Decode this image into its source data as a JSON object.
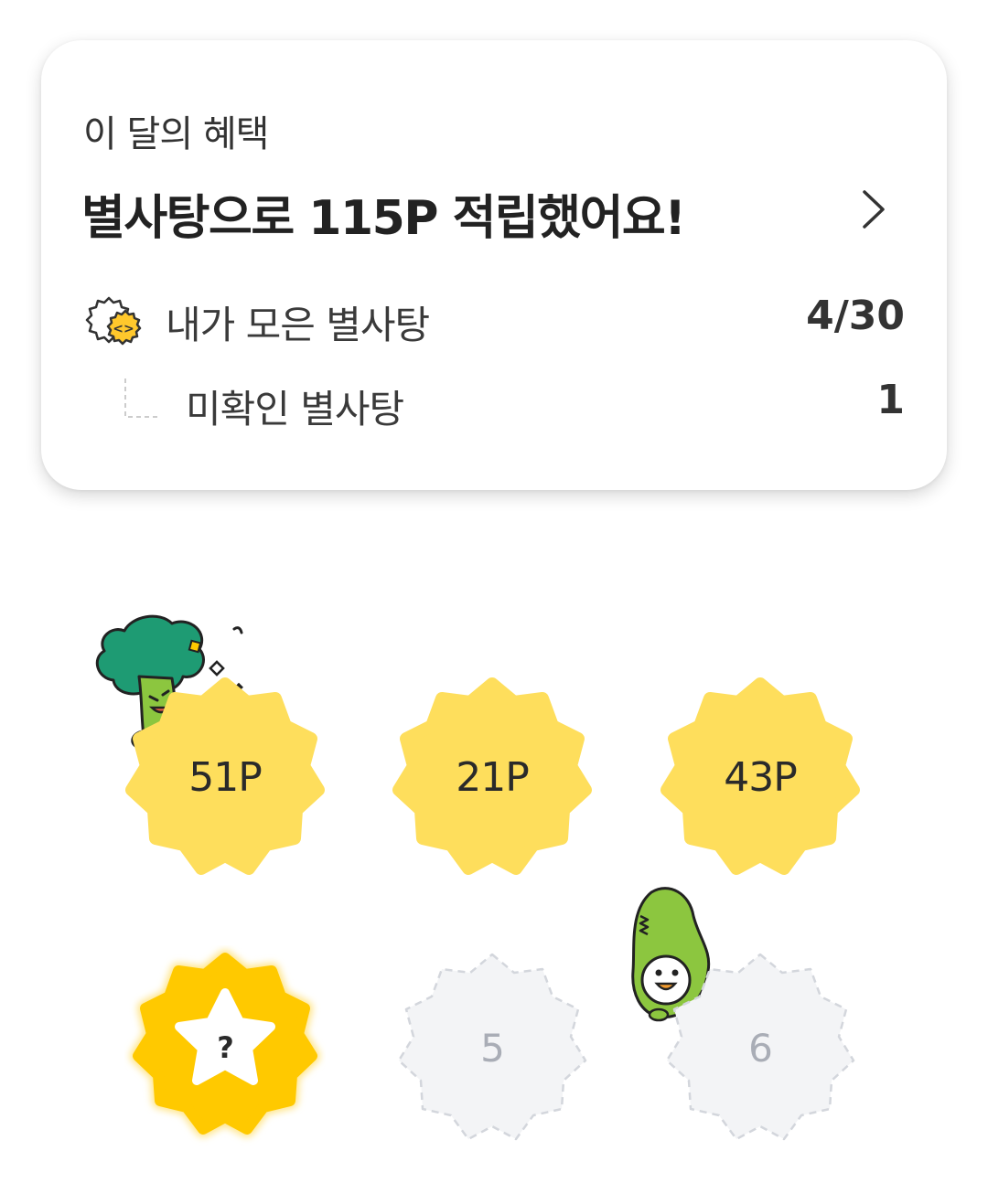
{
  "benefit_card": {
    "label": "이 달의 혜택",
    "title": "별사탕으로 115P 적립했어요!",
    "collected": {
      "label": "내가 모은 별사탕",
      "value": "4/30"
    },
    "unchecked": {
      "label": "미확인 별사탕",
      "value": "1"
    }
  },
  "candies": [
    {
      "text": "51P",
      "state": "collected"
    },
    {
      "text": "21P",
      "state": "collected"
    },
    {
      "text": "43P",
      "state": "collected"
    },
    {
      "text": "?",
      "state": "unchecked"
    },
    {
      "text": "5",
      "state": "empty"
    },
    {
      "text": "6",
      "state": "empty"
    }
  ],
  "colors": {
    "candy_yellow": "#FEDE5C",
    "candy_highlight": "#FFC900",
    "candy_empty": "#F3F4F6",
    "candy_empty_border": "#D3D6DC",
    "broccoli_green": "#1E9B73",
    "crocodile_green": "#8CC63F"
  },
  "icons": {
    "chevron": "chevron-right-icon",
    "candy": "star-candy-icon"
  }
}
